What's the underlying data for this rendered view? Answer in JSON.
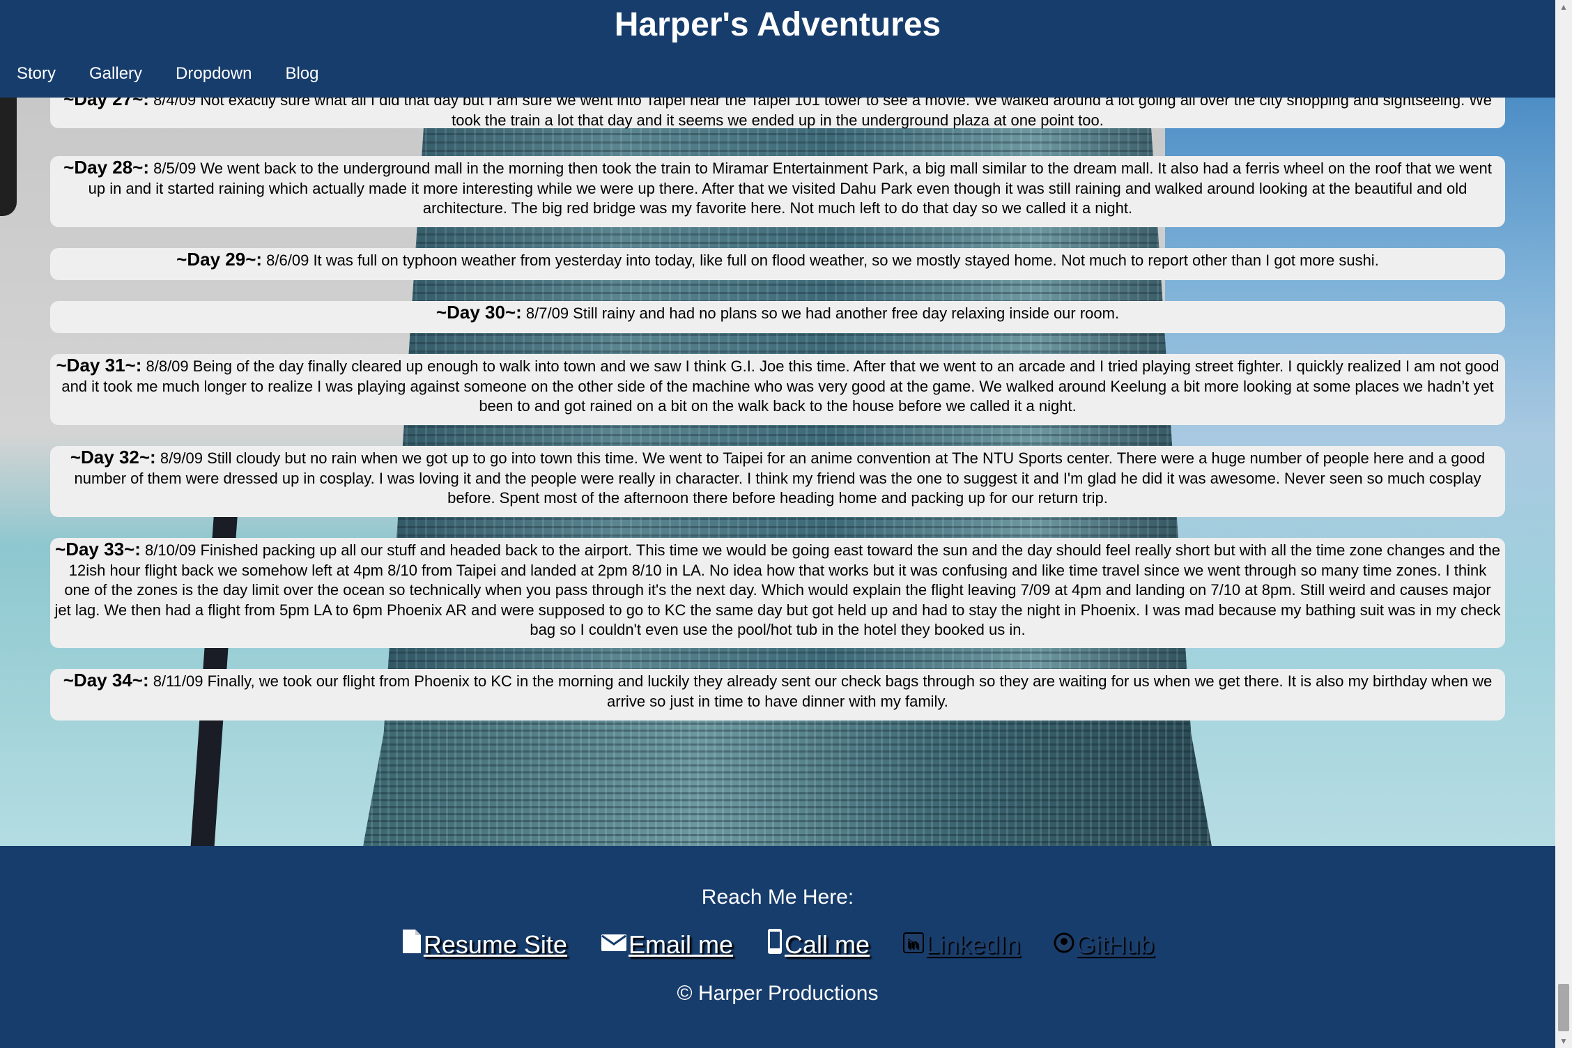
{
  "site": {
    "title": "Harper's Adventures"
  },
  "nav": {
    "items": [
      "Story",
      "Gallery",
      "Dropdown",
      "Blog"
    ]
  },
  "entries": [
    {
      "day": "~Day 27~:",
      "text": " 8/4/09 Not exactly sure what all I did that day but I am sure we went into Taipei near the Taipei 101 tower to see a movie. We walked around a lot going all over the city shopping and sightseeing. We took the train a lot that day and it seems we ended up in the underground plaza at one point too."
    },
    {
      "day": "~Day 28~:",
      "text": " 8/5/09 We went back to the underground mall in the morning then took the train to Miramar Entertainment Park, a big mall similar to the dream mall. It also had a ferris wheel on the roof that we went up in and it started raining which actually made it more interesting while we were up there. After that we visited Dahu Park even though it was still raining and walked around looking at the beautiful and old architecture. The big red bridge was my favorite here. Not much left to do that day so we called it a night."
    },
    {
      "day": "~Day 29~:",
      "text": " 8/6/09 It was full on typhoon weather from yesterday into today, like full on flood weather, so we mostly stayed home. Not much to report other than I got more sushi."
    },
    {
      "day": "~Day 30~:",
      "text": " 8/7/09 Still rainy and had no plans so we had another free day relaxing inside our room."
    },
    {
      "day": "~Day 31~:",
      "text": " 8/8/09 Being of the day finally cleared up enough to walk into town and we saw I think G.I. Joe this time. After that we went to an arcade and I tried playing street fighter. I quickly realized I am not good and it took me much longer to realize I was playing against someone on the other side of the machine who was very good at the game. We walked around Keelung a bit more looking at some places we hadn’t yet been to and got rained on a bit on the walk back to the house before we called it a night."
    },
    {
      "day": "~Day 32~:",
      "text": " 8/9/09 Still cloudy but no rain when we got up to go into town this time. We went to Taipei for an anime convention at The NTU Sports center. There were a huge number of people here and a good number of them were dressed up in cosplay. I was loving it and the people were really in character. I think my friend was the one to suggest it and I'm glad he did it was awesome. Never seen so much cosplay before. Spent most of the afternoon there before heading home and packing up for our return trip."
    },
    {
      "day": "~Day 33~:",
      "text": " 8/10/09 Finished packing up all our stuff and headed back to the airport. This time we would be going east toward the sun and the day should feel really short but with all the time zone changes and the 12ish hour flight back we somehow left at 4pm 8/10 from Taipei and landed at 2pm 8/10 in LA. No idea how that works but it was confusing and like time travel since we went through so many time zones. I think one of the zones is the day limit over the ocean so technically when you pass through it's the next day. Which would explain the flight leaving 7/09 at 4pm and landing on 7/10 at 8pm. Still weird and causes major jet lag. We then had a flight from 5pm LA to 6pm Phoenix AR and were supposed to go to KC the same day but got held up and had to stay the night in Phoenix. I was mad because my bathing suit was in my check bag so I couldn't even use the pool/hot tub in the hotel they booked us in."
    },
    {
      "day": "~Day 34~:",
      "text": " 8/11/09 Finally, we took our flight from Phoenix to KC in the morning and luckily they already sent our check bags through so they are waiting for us when we get there. It is also my birthday when we arrive so just in time to have dinner with my family."
    }
  ],
  "footer": {
    "reach": "Reach Me Here:",
    "links": [
      {
        "label": "Resume Site",
        "icon": "file-icon"
      },
      {
        "label": "Email me",
        "icon": "envelope-icon"
      },
      {
        "label": "Call me",
        "icon": "phone-icon"
      },
      {
        "label": "LinkedIn",
        "icon": "linkedin-icon"
      },
      {
        "label": "GitHub",
        "icon": "github-icon"
      }
    ],
    "copyright": "© Harper Productions"
  }
}
